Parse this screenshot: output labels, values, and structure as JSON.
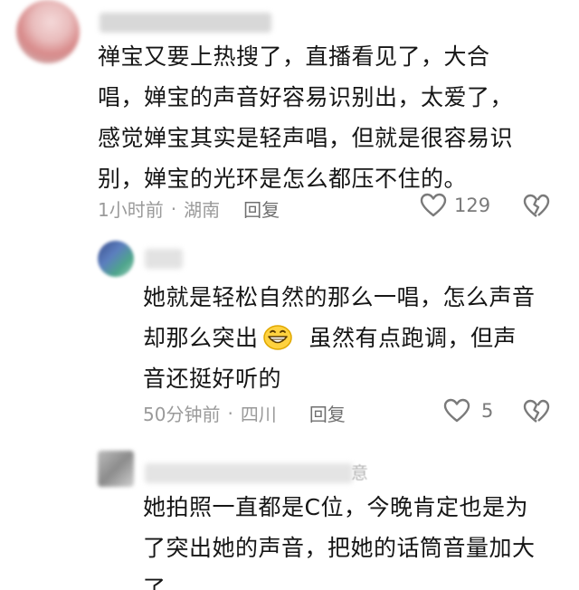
{
  "comments": [
    {
      "lines": [
        "禅宝又要上热搜了，直播看见了，大合",
        "唱，婵宝的声音好容易识别出，太爱了，",
        "感觉婵宝其实是轻声唱，但就是很容易识",
        "别，婵宝的光环是怎么都压不住的。"
      ],
      "time": "1小时前",
      "location": "湖南",
      "reply_label": "回复",
      "likes": "129"
    },
    {
      "line1": "她就是轻松自然的那么一唱，怎么声音",
      "line2_before": "却那么突出",
      "line2_emoji": "grinning-emoji",
      "line2_after": "虽然有点跑调，但声",
      "line3": "音还挺好听的",
      "time": "50分钟前",
      "location": "四川",
      "reply_label": "回复",
      "likes": "5"
    },
    {
      "name_tail": "意",
      "lines": [
        "她拍照一直都是C位，今晚肯定也是为",
        "了突出她的声音，把她的话筒音量加大",
        "了"
      ]
    }
  ],
  "icons": {
    "like": "heart-outline-icon",
    "dislike": "broken-heart-icon"
  },
  "colors": {
    "text": "#161616",
    "meta": "#9a9a9a",
    "icon": "#7a7a7a"
  }
}
